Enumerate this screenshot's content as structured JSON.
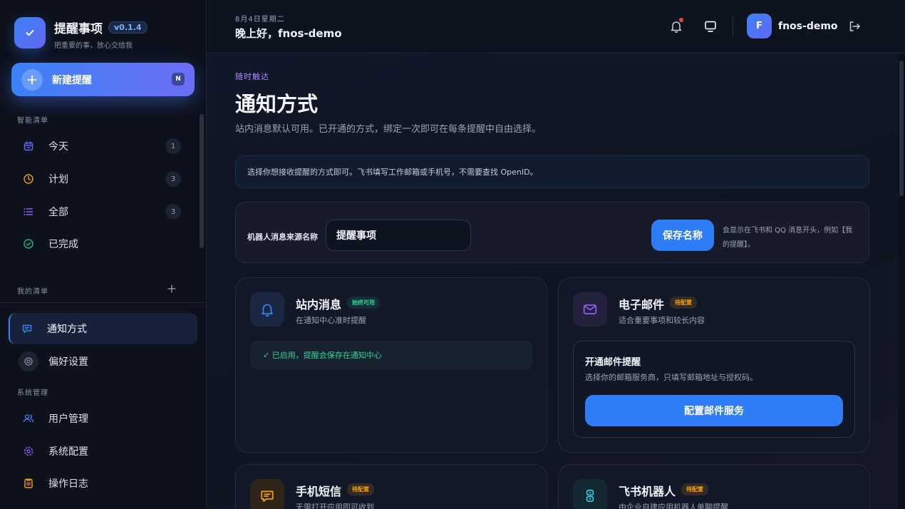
{
  "brand": {
    "title": "提醒事项",
    "version": "v0.1.4",
    "subtitle": "把重要的事，放心交给我"
  },
  "new_reminder": {
    "label": "新建提醒",
    "shortcut": "N"
  },
  "sidebar": {
    "smart_section": "智能清单",
    "smart_items": [
      {
        "label": "今天",
        "count": "1",
        "icon": "calendar-icon",
        "color": "#6366f1"
      },
      {
        "label": "计划",
        "count": "3",
        "icon": "clock-icon",
        "color": "#f59e0b"
      },
      {
        "label": "全部",
        "count": "3",
        "icon": "list-icon",
        "color": "#8b5cf6"
      },
      {
        "label": "已完成",
        "icon": "check-circle-icon",
        "color": "#10b981"
      }
    ],
    "my_lists_section": "我的清单",
    "list_items": [
      {
        "label": "通知方式",
        "icon": "message-icon",
        "active": true
      },
      {
        "label": "偏好设置",
        "icon": "settings-icon"
      }
    ],
    "system_section": "系统管理",
    "system_items": [
      {
        "label": "用户管理",
        "icon": "users-icon",
        "color": "#3b82f6"
      },
      {
        "label": "系统配置",
        "icon": "gear-icon",
        "color": "#8b5cf6"
      },
      {
        "label": "操作日志",
        "icon": "clipboard-icon",
        "color": "#f59e0b"
      }
    ]
  },
  "header": {
    "date": "8月4日星期二",
    "greeting": "晚上好，fnos-demo",
    "user": {
      "initial": "F",
      "name": "fnos-demo"
    }
  },
  "page": {
    "eyebrow": "随时触达",
    "title": "通知方式",
    "subtitle": "站内消息默认可用。已开通的方式，绑定一次即可在每条提醒中自由选择。",
    "info": "选择你想接收提醒的方式即可。飞书填写工作邮箱或手机号，不需要查找 OpenID。"
  },
  "sender_name": {
    "label": "机器人消息来源名称",
    "value": "提醒事项",
    "save_label": "保存名称",
    "hint": "会显示在飞书和 QQ 消息开头，例如【我的提醒】。"
  },
  "channels": [
    {
      "title": "站内消息",
      "badge": "始终可用",
      "desc": "在通知中心准时提醒",
      "status": "✓ 已启用，提醒会保存在通知中心"
    },
    {
      "title": "电子邮件",
      "badge": "待配置",
      "desc": "适合重要事项和较长内容",
      "setup_title": "开通邮件提醒",
      "setup_desc": "选择你的邮箱服务商，只填写邮箱地址与授权码。",
      "setup_button": "配置邮件服务"
    },
    {
      "title": "手机短信",
      "badge": "待配置",
      "desc": "无需打开应用即可收到"
    },
    {
      "title": "飞书机器人",
      "badge": "待配置",
      "desc": "由企业自建应用机器人单聊提醒"
    }
  ],
  "colors": {
    "accent": "#2f7df6",
    "success": "#34d399",
    "warning": "#f59e0b",
    "notification_dot": "#ef4444"
  }
}
